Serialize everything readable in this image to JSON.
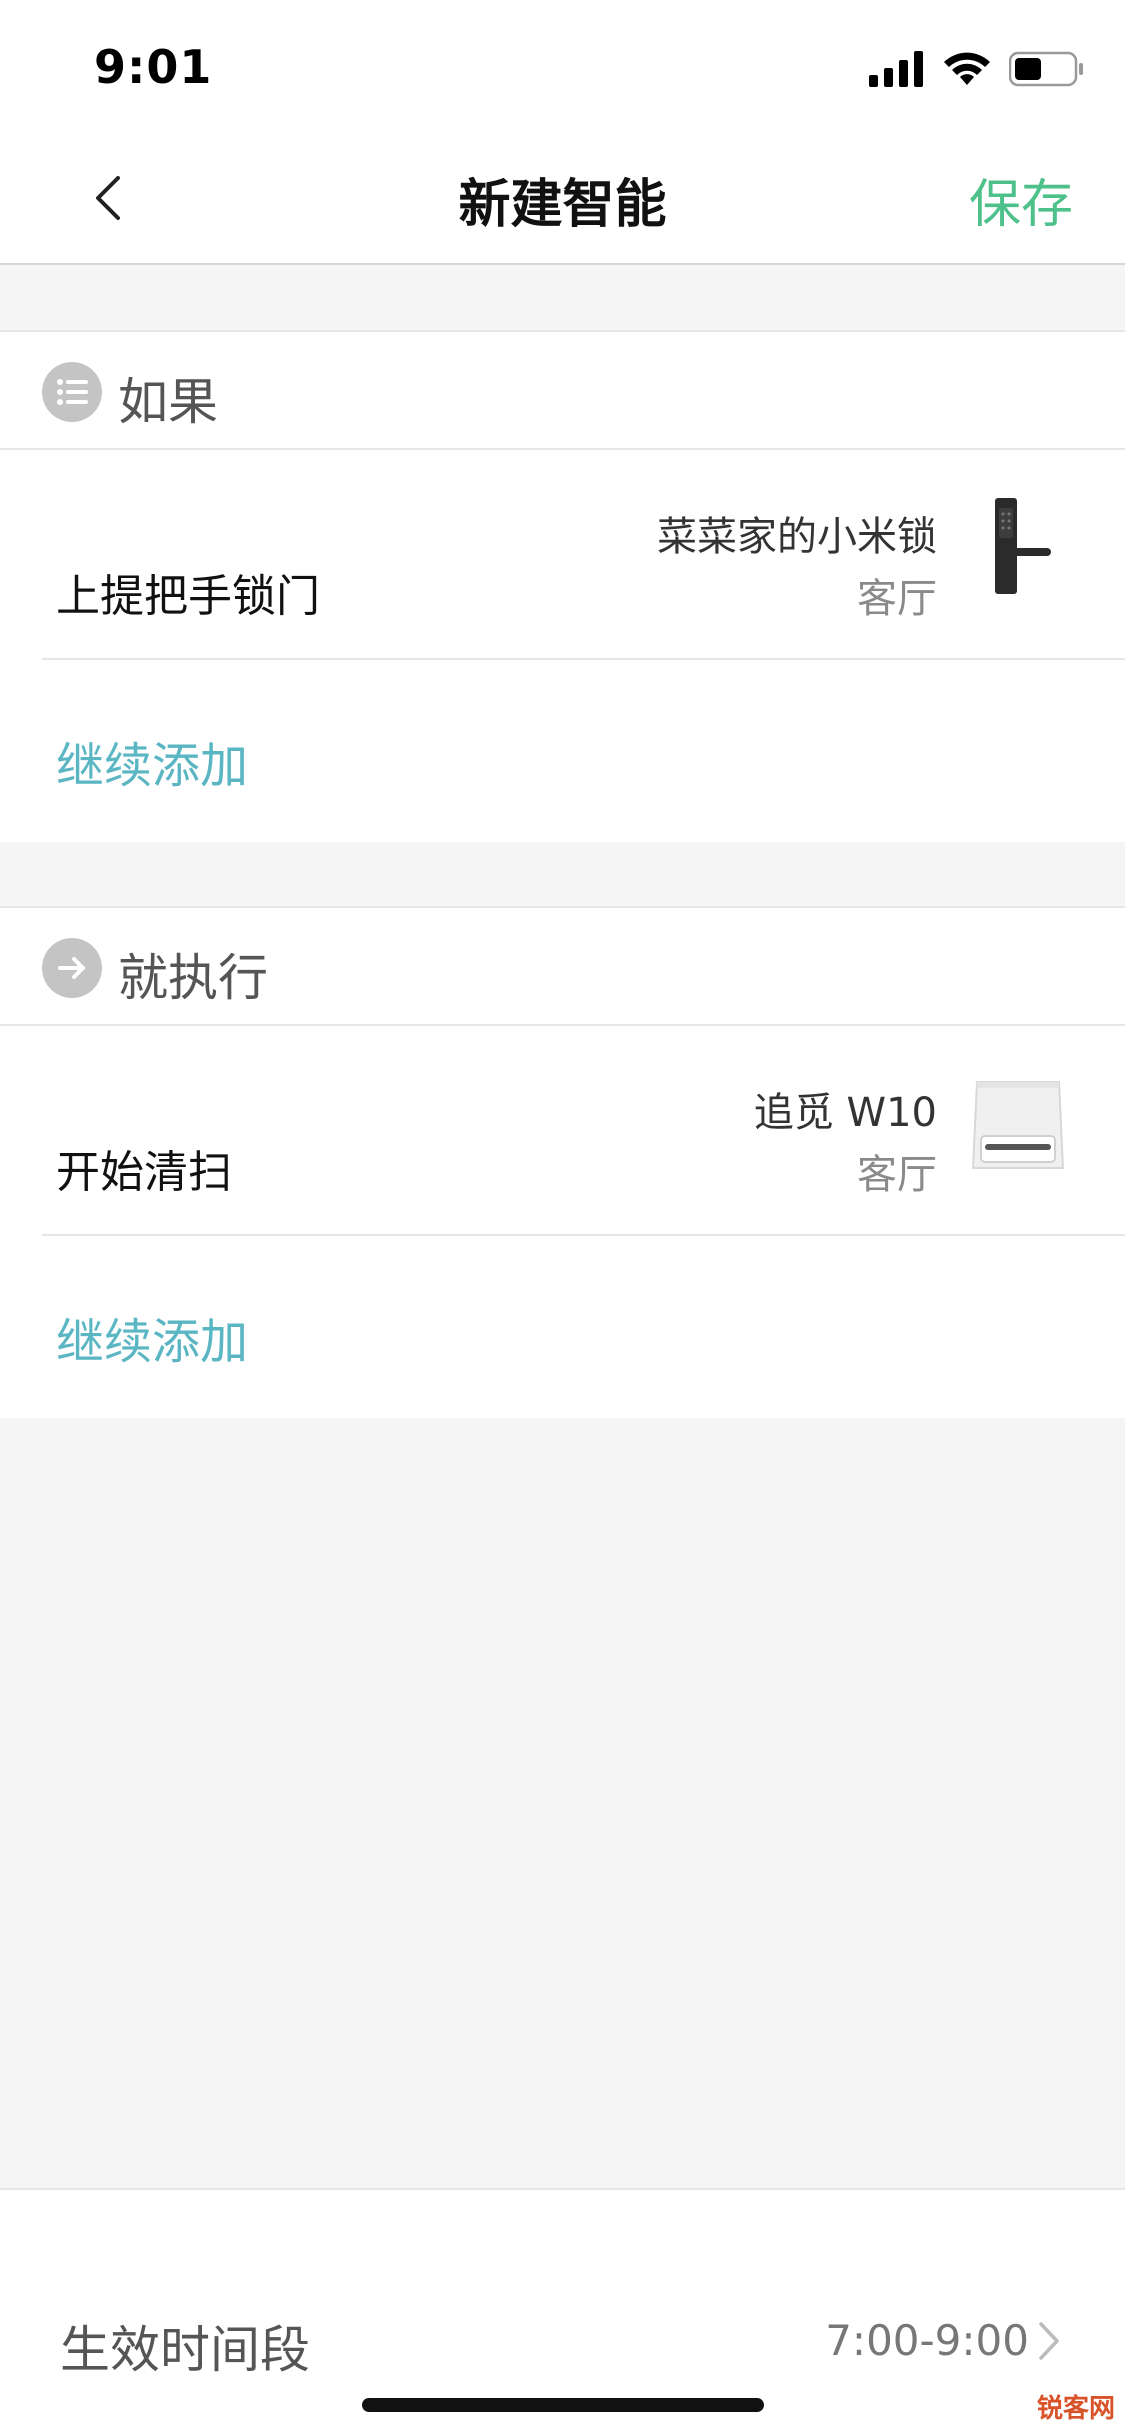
{
  "status_bar": {
    "time": "9:01",
    "icons": [
      "cellular-signal-icon",
      "wifi-icon",
      "battery-icon"
    ]
  },
  "nav": {
    "back_icon": "chevron-left-icon",
    "title": "新建智能",
    "save_label": "保存"
  },
  "if_section": {
    "icon": "list-icon",
    "label": "如果",
    "items": [
      {
        "action": "上提把手锁门",
        "device_name": "菜菜家的小米锁",
        "device_room": "客厅",
        "thumbnail": "smart-lock-icon"
      }
    ],
    "add_label": "继续添加"
  },
  "then_section": {
    "icon": "arrow-right-icon",
    "label": "就执行",
    "items": [
      {
        "action": "开始清扫",
        "device_name": "追觅 W10",
        "device_room": "客厅",
        "thumbnail": "robot-vacuum-dock-icon"
      }
    ],
    "add_label": "继续添加"
  },
  "effective_period": {
    "label": "生效时间段",
    "value": "7:00-9:00",
    "chevron_icon": "chevron-right-icon"
  },
  "watermark": "锐客网",
  "colors": {
    "accent_green": "#4ec18a",
    "link_teal": "#5ab6c2",
    "background": "#f5f5f5"
  }
}
